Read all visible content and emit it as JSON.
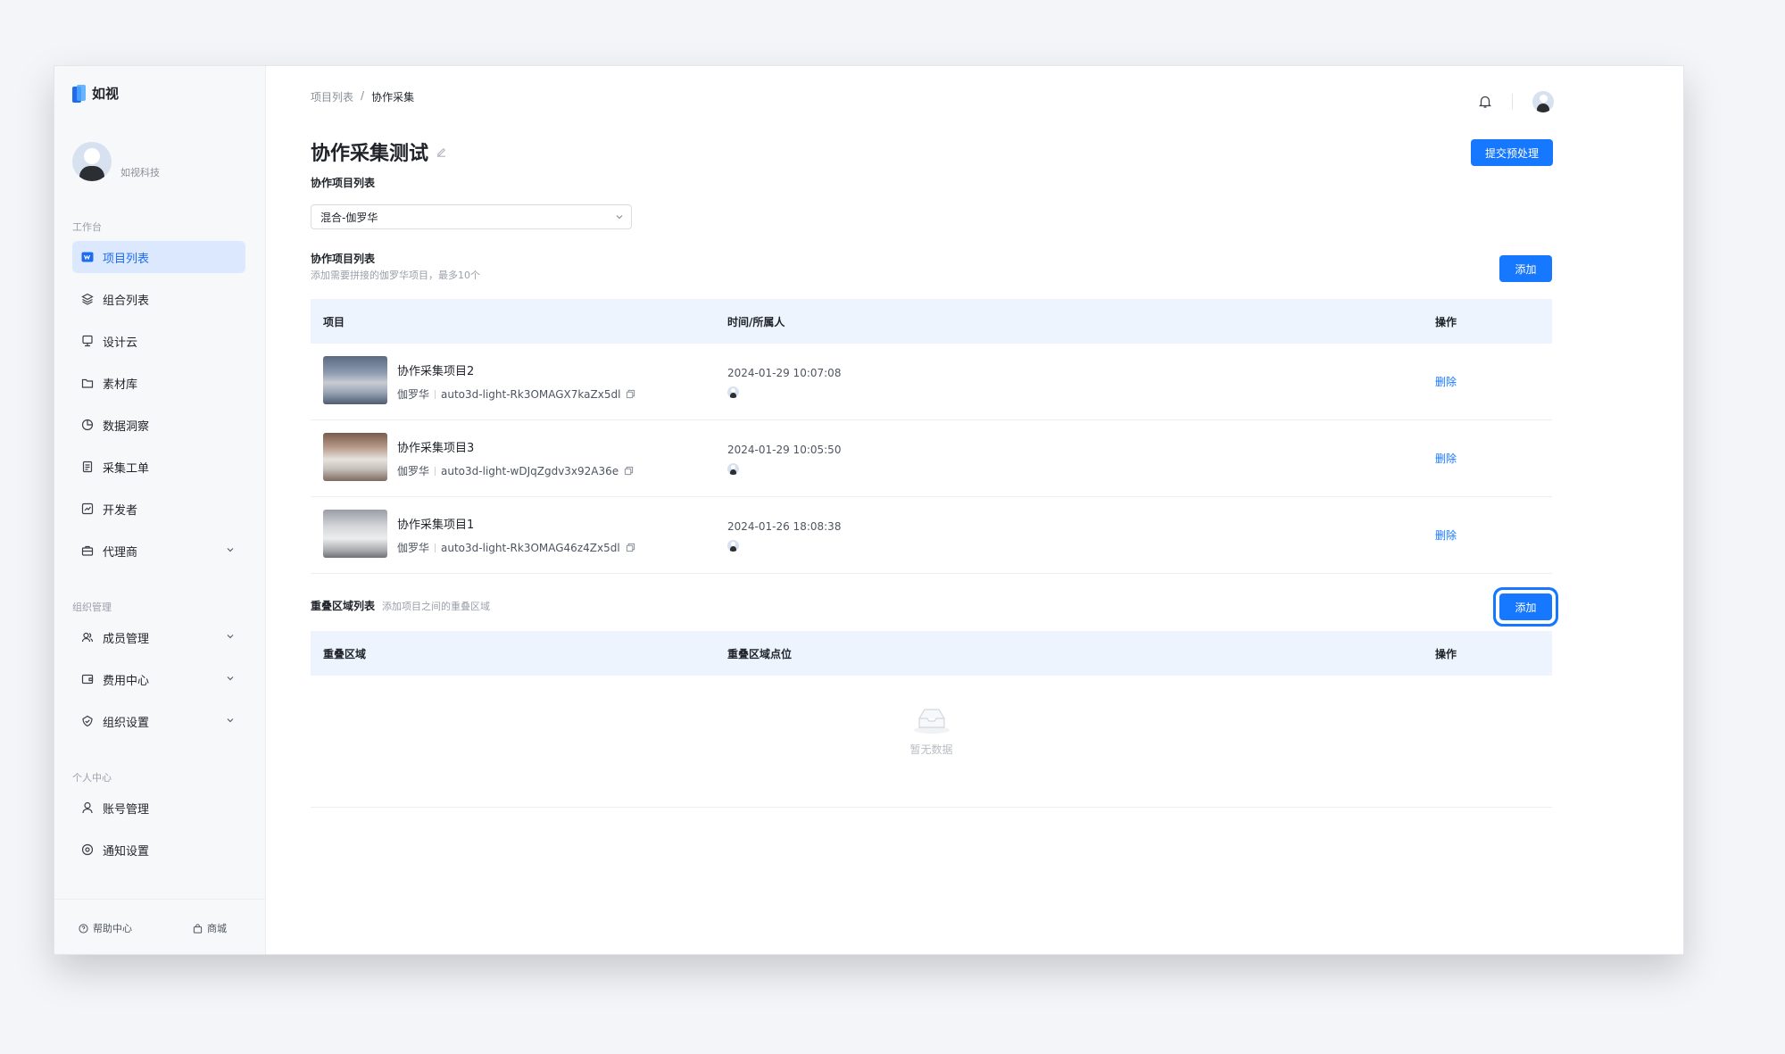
{
  "app": {
    "logo_text": "如视",
    "org_name": "如视科技"
  },
  "sidebar": {
    "sections": {
      "workspace": "工作台",
      "org": "组织管理",
      "personal": "个人中心"
    },
    "items": [
      {
        "label": "项目列表",
        "icon": "project-list-icon",
        "active": true
      },
      {
        "label": "组合列表",
        "icon": "layers-icon"
      },
      {
        "label": "设计云",
        "icon": "design-cloud-icon"
      },
      {
        "label": "素材库",
        "icon": "folder-icon"
      },
      {
        "label": "数据洞察",
        "icon": "pie-chart-icon"
      },
      {
        "label": "采集工单",
        "icon": "document-icon"
      },
      {
        "label": "开发者",
        "icon": "developer-icon"
      },
      {
        "label": "代理商",
        "icon": "briefcase-icon",
        "expandable": true
      },
      {
        "label": "成员管理",
        "icon": "members-icon",
        "expandable": true
      },
      {
        "label": "费用中心",
        "icon": "wallet-icon",
        "expandable": true
      },
      {
        "label": "组织设置",
        "icon": "shield-icon",
        "expandable": true
      },
      {
        "label": "账号管理",
        "icon": "user-icon"
      },
      {
        "label": "通知设置",
        "icon": "settings-icon"
      }
    ],
    "footer": {
      "help": "帮助中心",
      "mall": "商城"
    }
  },
  "header": {
    "breadcrumb": [
      "项目列表",
      "/",
      "协作采集"
    ],
    "title": "协作采集测试",
    "submit_button": "提交预处理"
  },
  "collab": {
    "select_label": "协作项目列表",
    "select_value": "混合-伽罗华",
    "list_title": "协作项目列表",
    "list_hint": "添加需要拼接的伽罗华项目，最多10个",
    "add_button": "添加",
    "columns": {
      "project": "项目",
      "time_owner": "时间/所属人",
      "action": "操作"
    },
    "rows": [
      {
        "name": "协作采集项目2",
        "device": "伽罗华",
        "code": "auto3d-light-Rk3OMAGX7kaZx5dl",
        "time": "2024-01-29 10:07:08",
        "action": "删除"
      },
      {
        "name": "协作采集项目3",
        "device": "伽罗华",
        "code": "auto3d-light-wDJqZgdv3x92A36e",
        "time": "2024-01-29 10:05:50",
        "action": "删除"
      },
      {
        "name": "协作采集项目1",
        "device": "伽罗华",
        "code": "auto3d-light-Rk3OMAG46z4Zx5dl",
        "time": "2024-01-26 18:08:38",
        "action": "删除"
      }
    ]
  },
  "overlap": {
    "title": "重叠区域列表",
    "hint": "添加项目之间的重叠区域",
    "add_button": "添加",
    "columns": {
      "area": "重叠区域",
      "points": "重叠区域点位",
      "action": "操作"
    },
    "empty_text": "暂无数据"
  },
  "colors": {
    "primary": "#1677ff",
    "header_bg": "#eef4fd",
    "active_nav_bg": "#dce8fd"
  }
}
